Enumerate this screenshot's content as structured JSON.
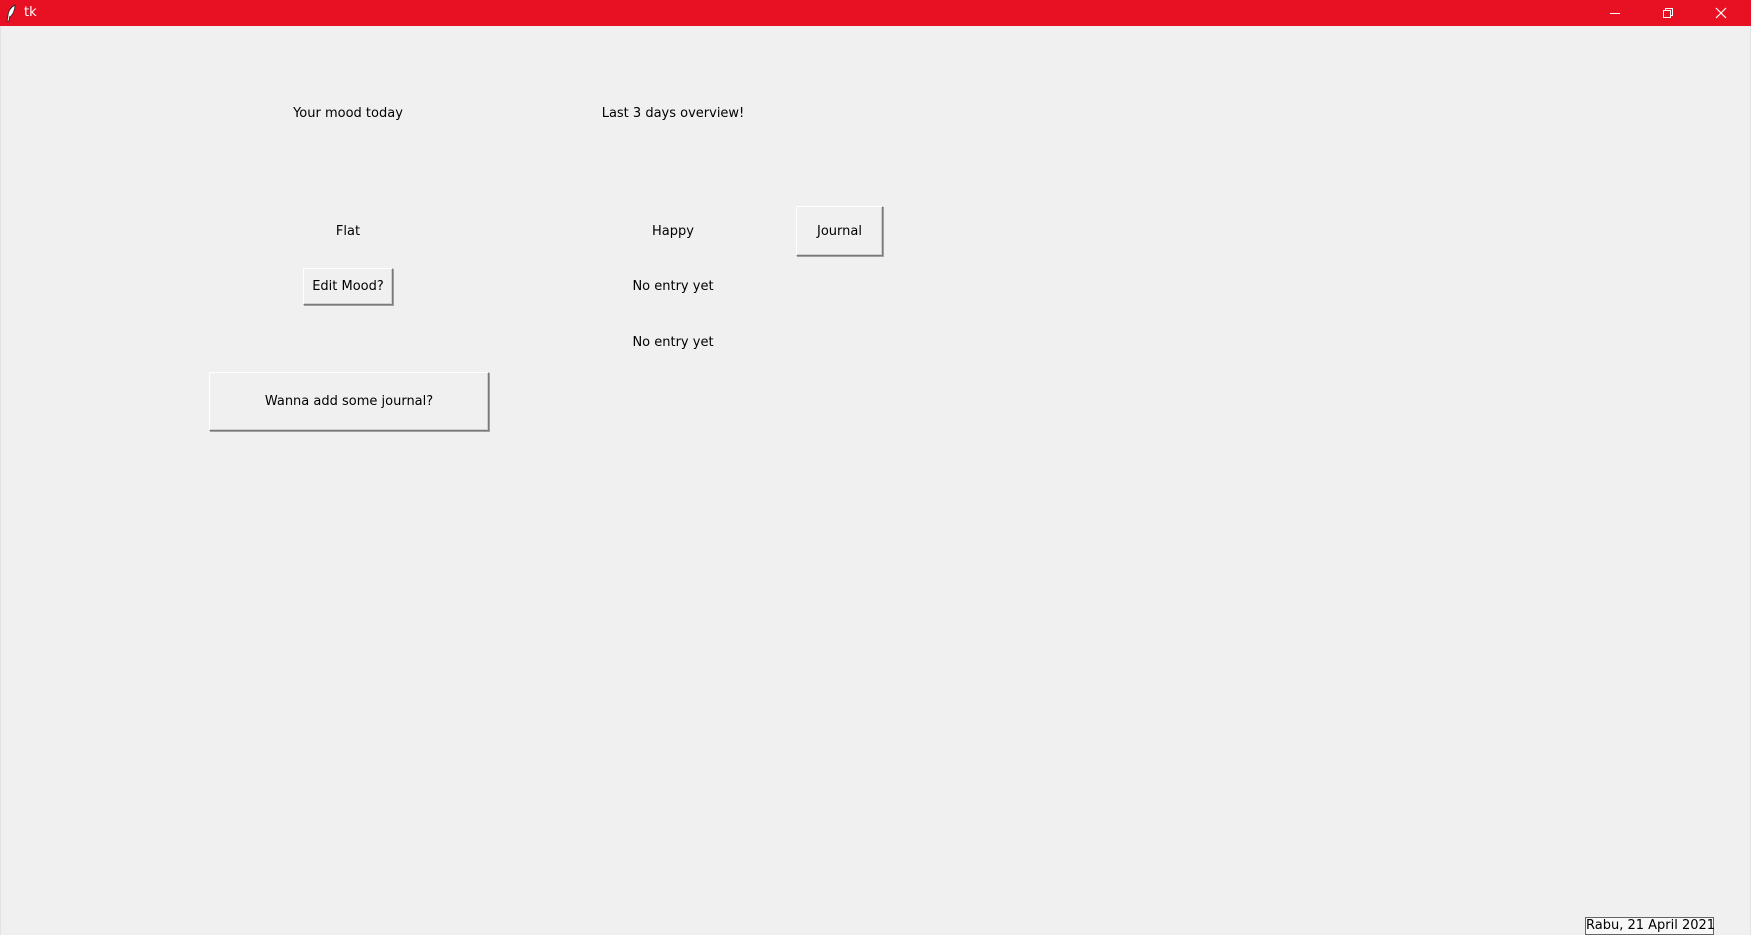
{
  "window": {
    "title": "tk",
    "titlebar_color": "#e81123",
    "controls": [
      "minimize-icon",
      "restore-icon",
      "close-icon"
    ]
  },
  "today": {
    "heading": "Your mood today",
    "mood": "Flat",
    "edit_button": "Edit Mood?",
    "journal_button": "Wanna add some journal?"
  },
  "overview": {
    "heading": "Last 3 days overview!",
    "entries": [
      "Happy",
      "No entry yet",
      "No entry yet"
    ],
    "journal_button": "Journal"
  },
  "status": {
    "date": "Rabu, 21 April 2021"
  }
}
